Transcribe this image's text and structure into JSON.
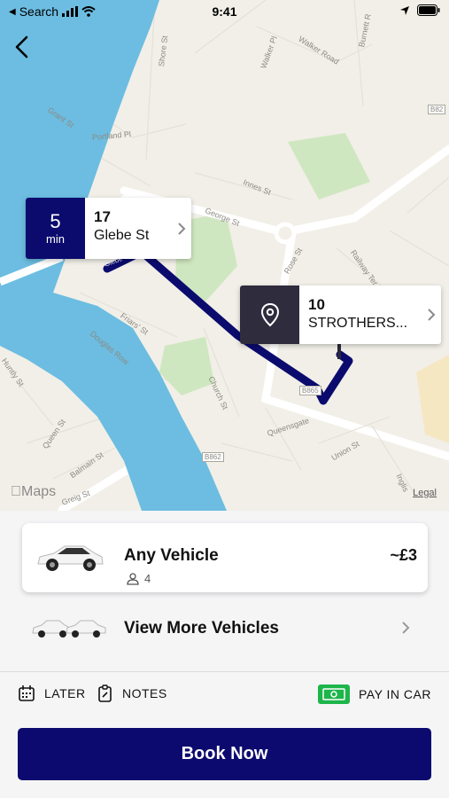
{
  "status_bar": {
    "back_app": "Search",
    "time": "9:41"
  },
  "map": {
    "streets": [
      "Shore St",
      "Walker Pl",
      "Walker Road",
      "Burnett R",
      "Grant St",
      "Portland Pl",
      "Innes St",
      "George St",
      "Railway Ter",
      "Rose St",
      "Friars' St",
      "Douglas Row",
      "Church St",
      "Huntly St",
      "B865",
      "Queensgate",
      "B862",
      "Union St",
      "Queen St",
      "Balmain St",
      "Greig St",
      "Inglis",
      "Glebe",
      "B82"
    ],
    "attribution": "Maps",
    "legal": "Legal"
  },
  "pickup": {
    "eta_value": "5",
    "eta_unit": "min",
    "number": "17",
    "street": "Glebe St"
  },
  "destination": {
    "number": "10",
    "street": "STROTHERS..."
  },
  "vehicle": {
    "name": "Any Vehicle",
    "seats": "4",
    "price": "~£3"
  },
  "more_vehicles": {
    "label": "View More Vehicles"
  },
  "actions": {
    "later": "LATER",
    "notes": "NOTES",
    "pay": "PAY IN CAR"
  },
  "book_button": {
    "label": "Book Now"
  },
  "colors": {
    "route": "#0b0b6e",
    "river": "#6cbde1",
    "brand": "#0c0a6e",
    "cash": "#1eb54b"
  }
}
